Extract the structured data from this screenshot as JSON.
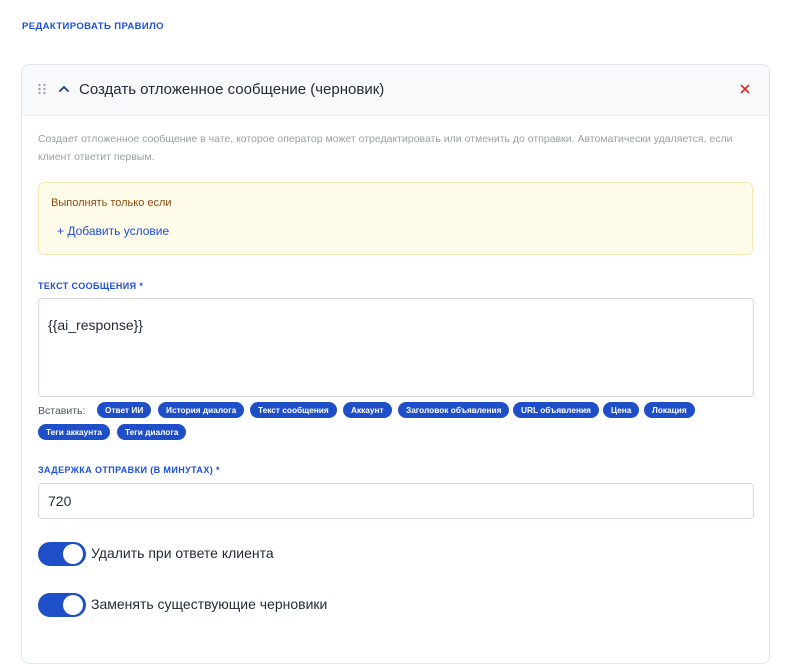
{
  "page": {
    "title": "РЕДАКТИРОВАТЬ ПРАВИЛО"
  },
  "rule": {
    "title": "Создать отложенное сообщение (черновик)",
    "description": "Создает отложенное сообщение в чате, которое оператор может отредактировать или отменить до отправки. Автоматически удаляется, если клиент ответит первым."
  },
  "condition": {
    "title": "Выполнять только если",
    "add_label": "+ Добавить условие"
  },
  "message": {
    "label": "ТЕКСТ СООБЩЕНИЯ *",
    "value": "{{ai_response}}"
  },
  "insert": {
    "label": "Вставить:",
    "chips": [
      "Ответ ИИ",
      "История диалога",
      "Текст сообщения",
      "Аккаунт",
      "Заголовок объявления",
      "URL объявления",
      "Цена",
      "Локация",
      "Теги аккаунта",
      "Теги диалога"
    ]
  },
  "delay": {
    "label": "ЗАДЕРЖКА ОТПРАВКИ (В МИНУТАХ) *",
    "value": "720"
  },
  "toggles": [
    {
      "label": "Удалить при ответе клиента",
      "on": true
    },
    {
      "label": "Заменять существующие черновики",
      "on": true
    }
  ],
  "colors": {
    "accent": "#1f4fc8",
    "close": "#dc2626",
    "warning_bg": "#fefbe8"
  }
}
